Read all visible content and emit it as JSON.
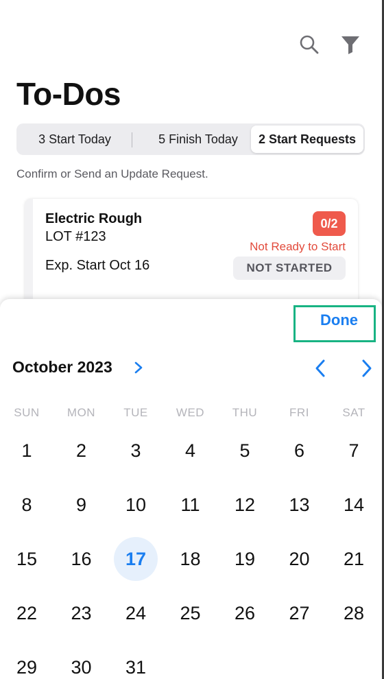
{
  "header": {
    "title": "To-Dos"
  },
  "icons": {
    "search": "search-icon",
    "filter": "filter-icon"
  },
  "tabs": [
    {
      "label": "3 Start Today",
      "selected": false
    },
    {
      "label": "5 Finish Today",
      "selected": false
    },
    {
      "label": "2 Start Requests",
      "selected": true
    }
  ],
  "hint": "Confirm or Send an Update Request.",
  "card": {
    "name": "Electric Rough",
    "lot": "LOT #123",
    "expected_start": "Exp. Start Oct 16",
    "count": "0/2",
    "readiness": "Not Ready to Start",
    "status": "NOT STARTED"
  },
  "picker": {
    "done_label": "Done",
    "month_label": "October 2023",
    "weekdays": [
      "SUN",
      "MON",
      "TUE",
      "WED",
      "THU",
      "FRI",
      "SAT"
    ],
    "weeks": [
      [
        "1",
        "2",
        "3",
        "4",
        "5",
        "6",
        "7"
      ],
      [
        "8",
        "9",
        "10",
        "11",
        "12",
        "13",
        "14"
      ],
      [
        "15",
        "16",
        "17",
        "18",
        "19",
        "20",
        "21"
      ],
      [
        "22",
        "23",
        "24",
        "25",
        "26",
        "27",
        "28"
      ],
      [
        "29",
        "30",
        "31"
      ]
    ],
    "selected_day": "17"
  },
  "colors": {
    "accent": "#1a7ef0",
    "badge": "#ef5a4c",
    "warning_text": "#e24a3b",
    "highlight_border": "#18b383",
    "selected_day_bg": "#e6f0fc"
  }
}
